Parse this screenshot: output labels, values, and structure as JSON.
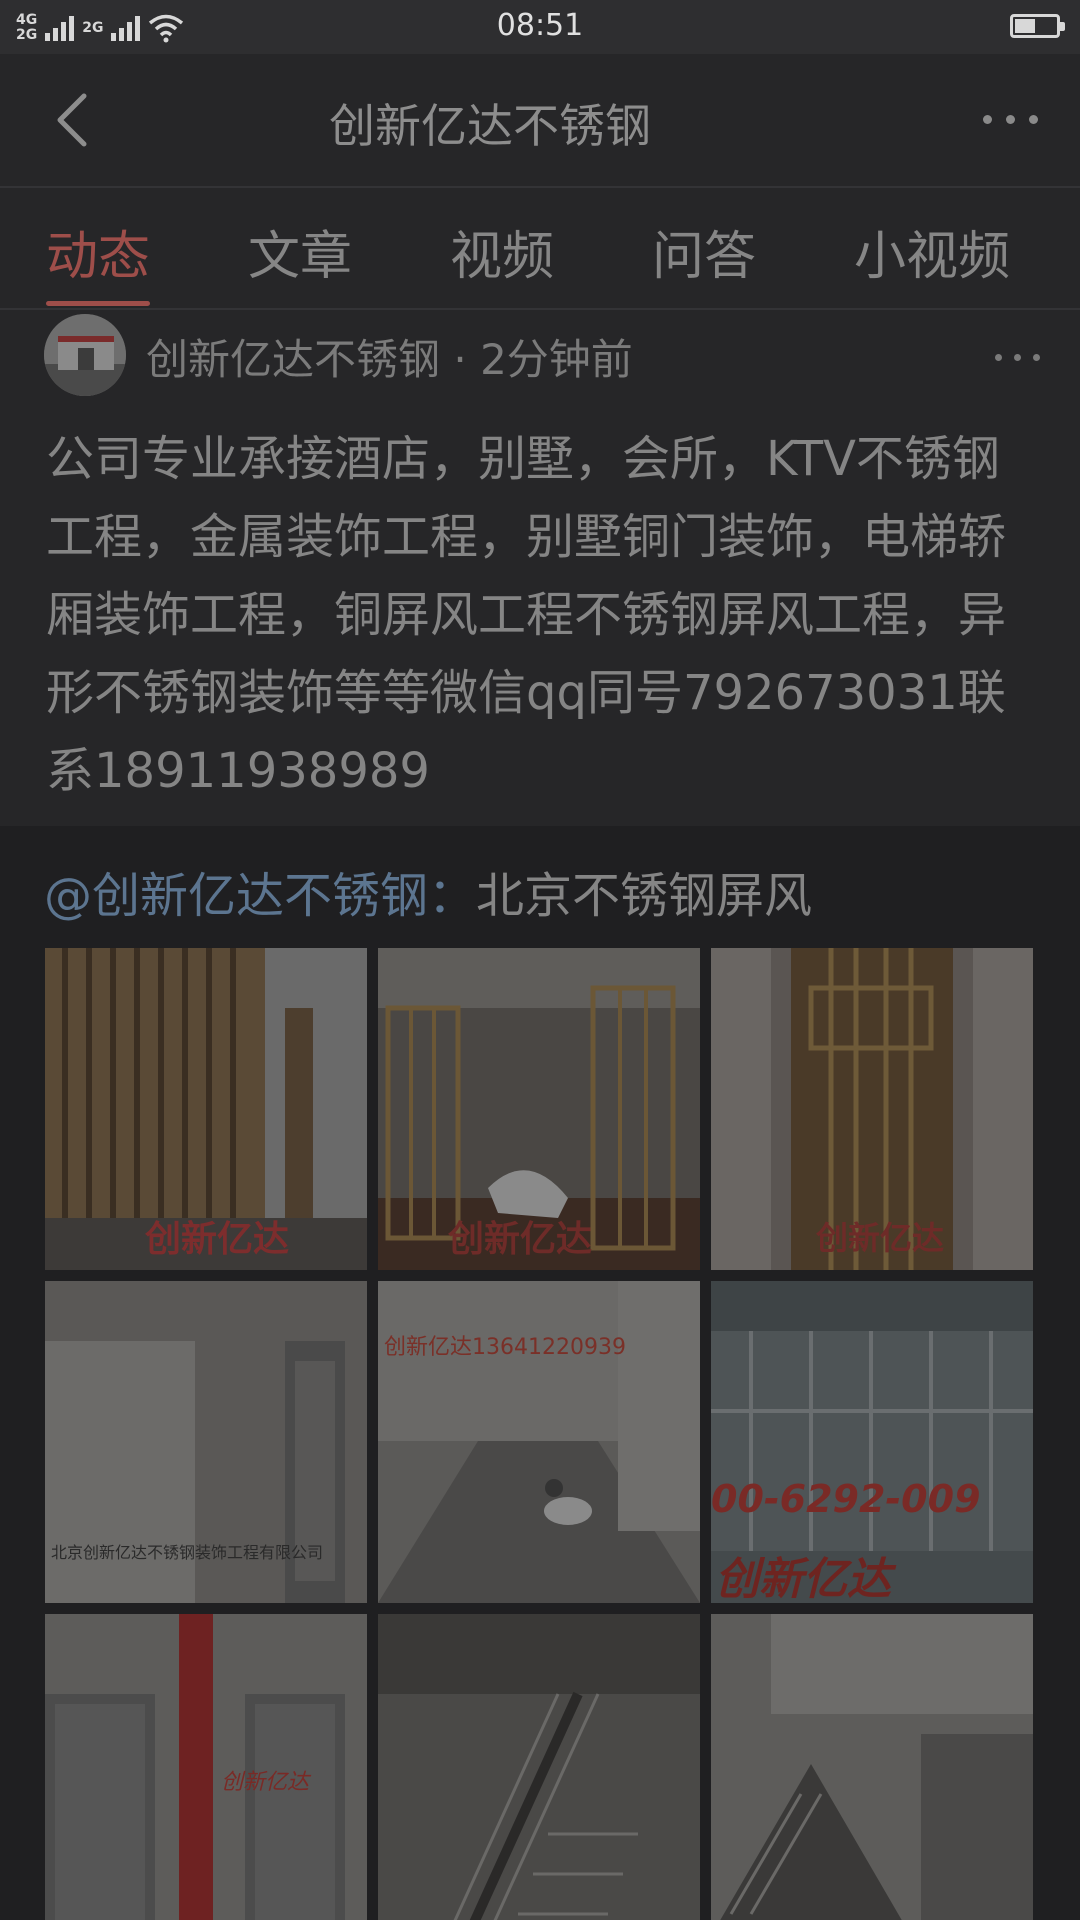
{
  "status_bar": {
    "network_top": "4G",
    "network_bottom": "2G",
    "network2": "2G",
    "time": "08:51",
    "battery_level": 0.45
  },
  "nav": {
    "title": "创新亿达不锈钢",
    "back_icon": "chevron-left-icon",
    "more_icon": "more-dots-icon"
  },
  "tabs": [
    {
      "label": "动态",
      "active": true
    },
    {
      "label": "文章",
      "active": false
    },
    {
      "label": "视频",
      "active": false
    },
    {
      "label": "问答",
      "active": false
    },
    {
      "label": "小视频",
      "active": false
    }
  ],
  "post": {
    "author": "创新亿达不锈钢",
    "separator": " · ",
    "time": "2分钟前",
    "body": "公司专业承接酒店，别墅，会所，KTV不锈钢工程，金属装饰工程，别墅铜门装饰，电梯轿厢装饰工程，铜屏风工程不锈钢屏风工程，异形不锈钢装饰等等微信qq同号792673031联系18911938989"
  },
  "repost": {
    "mention": "@创新亿达不锈钢",
    "colon": "：",
    "text": "北京不锈钢屏风"
  },
  "photos": {
    "p1_watermark": "创新亿达",
    "p2_watermark": "创新亿达",
    "p3_watermark": "创新亿达",
    "p4_caption": "北京创新亿达不锈钢装饰工程有限公司",
    "p5_watermark": "创新亿达13641220939",
    "p6_phone": "00-6292-009",
    "p6_watermark": "创新亿达",
    "p7_watermark": "创新亿达"
  }
}
